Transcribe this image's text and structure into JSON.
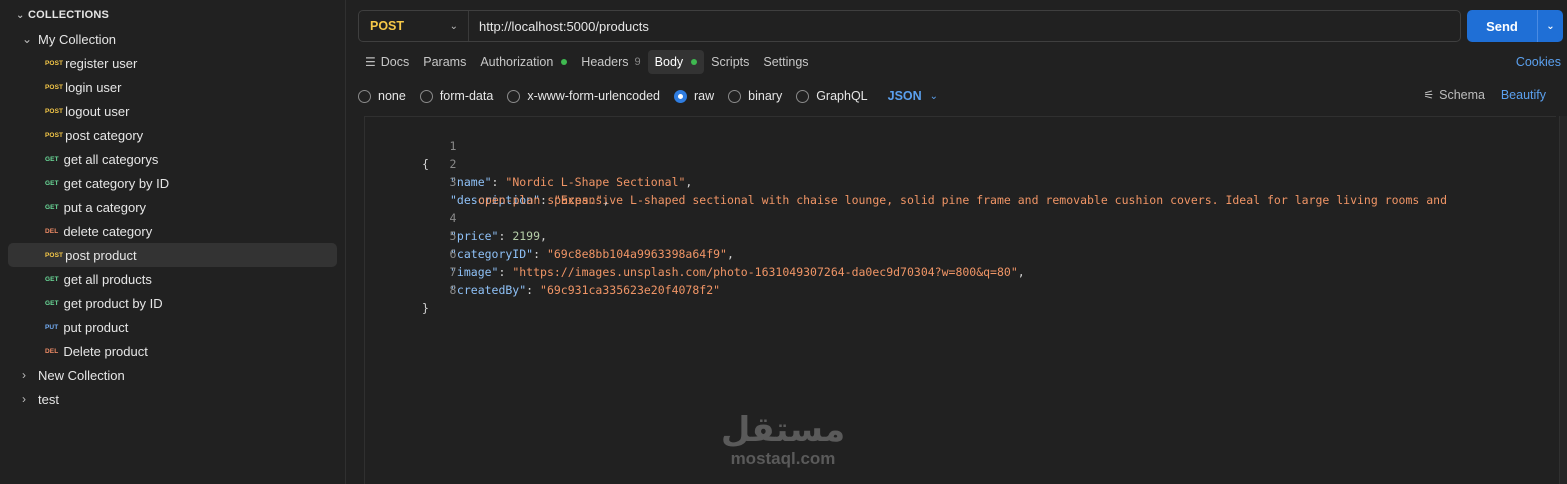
{
  "sidebar": {
    "section_title": "COLLECTIONS",
    "collections": [
      {
        "name": "My Collection",
        "expanded": true
      },
      {
        "name": "New Collection",
        "expanded": false
      },
      {
        "name": "test",
        "expanded": false
      }
    ],
    "requests": [
      {
        "method": "POST",
        "name": "register user"
      },
      {
        "method": "POST",
        "name": "login user"
      },
      {
        "method": "POST",
        "name": "logout user"
      },
      {
        "method": "POST",
        "name": "post category"
      },
      {
        "method": "GET",
        "name": "get all categorys"
      },
      {
        "method": "GET",
        "name": "get category by ID"
      },
      {
        "method": "GET",
        "name": "put a category"
      },
      {
        "method": "DEL",
        "name": "delete category"
      },
      {
        "method": "POST",
        "name": "post product",
        "active": true
      },
      {
        "method": "GET",
        "name": "get all products"
      },
      {
        "method": "GET",
        "name": "get product by ID"
      },
      {
        "method": "PUT",
        "name": "put product"
      },
      {
        "method": "DEL",
        "name": "Delete product"
      }
    ]
  },
  "request": {
    "method": "POST",
    "url": "http://localhost:5000/products",
    "send_label": "Send"
  },
  "tabs": {
    "docs": "Docs",
    "params": "Params",
    "authorization": "Authorization",
    "headers": "Headers",
    "headers_count": "9",
    "body": "Body",
    "scripts": "Scripts",
    "settings": "Settings",
    "cookies": "Cookies"
  },
  "body_types": {
    "none": "none",
    "form_data": "form-data",
    "urlencoded": "x-www-form-urlencoded",
    "raw": "raw",
    "binary": "binary",
    "graphql": "GraphQL",
    "format": "JSON",
    "selected": "raw",
    "schema": "Schema",
    "beautify": "Beautify"
  },
  "code_lines": {
    "1": "{",
    "2k": "\"name\"",
    "2v": "\"Nordic L-Shape Sectional\"",
    "3k": "\"description\"",
    "3v": "\"Expansive L-shaped sectional with chaise lounge, solid pine frame and removable cushion covers. Ideal for large living rooms and",
    "3w": "open-plan spaces.\"",
    "4k": "\"price\"",
    "4v": "2199",
    "5k": "\"categoryID\"",
    "5v": "\"69c8e8bb104a9963398a64f9\"",
    "6k": "\"image\"",
    "6v": "\"https://images.unsplash.com/photo-1631049307264-da0ec9d70304?w=800&q=80\"",
    "7k": "\"createdBy\"",
    "7v": "\"69c931ca335623e20f4078f2\"",
    "8": "}"
  },
  "line_numbers": [
    "1",
    "2",
    "3",
    "4",
    "5",
    "6",
    "7",
    "8"
  ],
  "watermark": {
    "arabic": "مستقل",
    "latin": "mostaql.com"
  },
  "colors": {
    "accent": "#1f6fd6",
    "post": "#f7c948",
    "get": "#6bdd9a",
    "delete": "#f08c66",
    "put": "#74aef6"
  }
}
